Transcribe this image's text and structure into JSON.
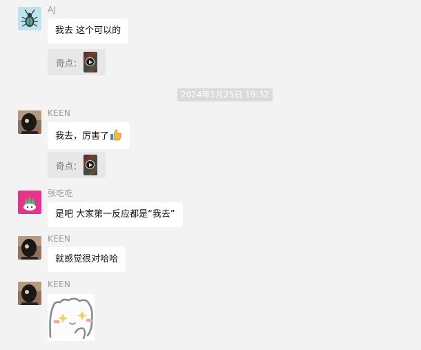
{
  "messages": [
    {
      "sender": "AJ",
      "text": "我去 这个可以的",
      "quote_label": "奇点："
    },
    {
      "timestamp": "2024年1月25日 19:32"
    },
    {
      "sender": "KEEN",
      "text": "我去，厉害了",
      "emoji": "thumbs-up",
      "quote_label": "奇点："
    },
    {
      "sender": "张吃吃",
      "text": "是吧 大家第一反应都是“我去”"
    },
    {
      "sender": "KEEN",
      "text": "就感觉很对哈哈"
    },
    {
      "sender": "KEEN",
      "sticker": "cute-bear-sparkle-sticker"
    }
  ],
  "colors": {
    "background": "#f3f3f3",
    "bubble": "#ffffff",
    "quote_bg": "#e7e7e7",
    "sender_name": "#9b9b9b",
    "timestamp_bg": "#dadada"
  }
}
